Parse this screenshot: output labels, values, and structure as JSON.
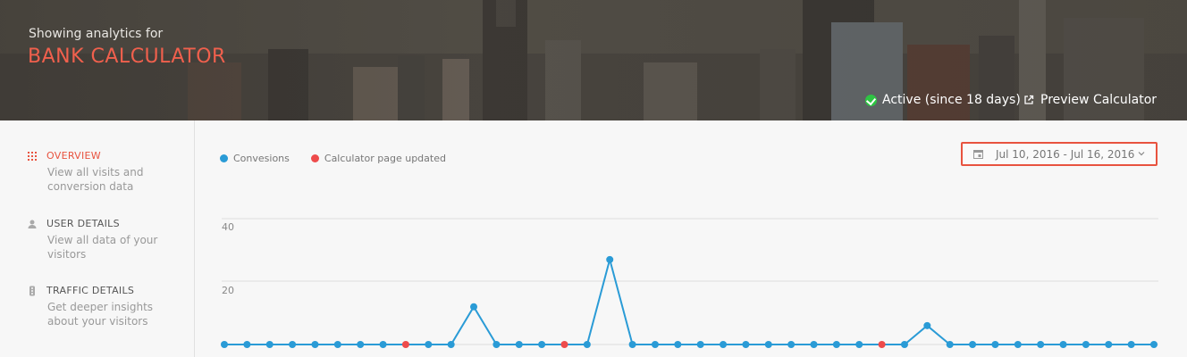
{
  "header": {
    "subtitle": "Showing analytics for",
    "app_title": "BANK CALCULATOR",
    "status_text": "Active (since 18 days)",
    "status_icon": "check-circle-icon",
    "preview_label": "Preview Calculator",
    "preview_icon": "external-link-icon"
  },
  "sidebar": {
    "items": [
      {
        "label": "OVERVIEW",
        "description": "View all visits and conversion data",
        "icon": "grid-dots-icon",
        "active": true
      },
      {
        "label": "USER DETAILS",
        "description": "View all data of your visitors",
        "icon": "user-icon",
        "active": false
      },
      {
        "label": "TRAFFIC DETAILS",
        "description": "Get deeper insights about your visitors",
        "icon": "traffic-icon",
        "active": false
      }
    ]
  },
  "main": {
    "date_range": "Jul 10, 2016 - Jul 16, 2016"
  },
  "colors": {
    "accent": "#e8533f",
    "conversions": "#2a9bd6",
    "updated": "#ee4b4b",
    "active": "#2ec443"
  },
  "chart_data": {
    "type": "line",
    "legend": [
      "Convesions",
      "Calculator page updated"
    ],
    "y_ticks": [
      "40",
      "20"
    ],
    "ylim": [
      0,
      40
    ],
    "series": [
      {
        "name": "Convesions",
        "values": [
          0,
          0,
          0,
          0,
          0,
          0,
          0,
          0,
          0,
          0,
          0,
          12,
          0,
          0,
          0,
          0,
          0,
          27,
          0,
          0,
          0,
          0,
          0,
          0,
          0,
          0,
          0,
          0,
          0,
          0,
          0,
          6,
          0,
          0,
          0,
          0,
          0,
          0,
          0,
          0,
          0,
          0
        ]
      }
    ],
    "update_markers": [
      8,
      15,
      29
    ]
  }
}
